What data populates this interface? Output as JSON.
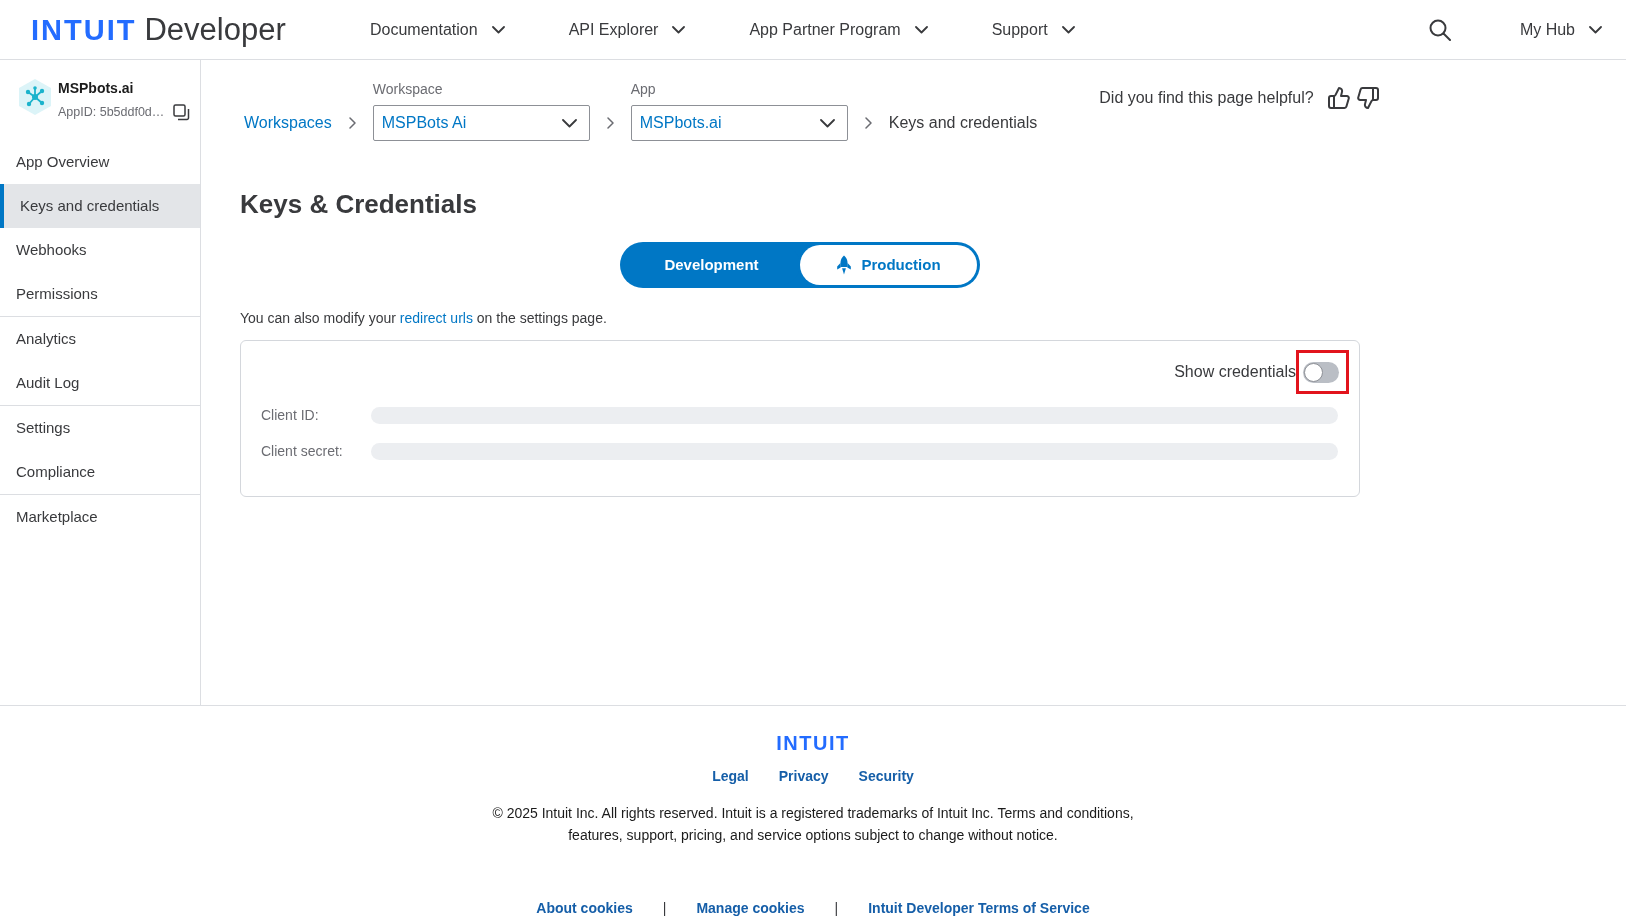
{
  "header": {
    "logo": "INTUIT",
    "product": "Developer",
    "nav": [
      {
        "label": "Documentation"
      },
      {
        "label": "API Explorer"
      },
      {
        "label": "App Partner Program"
      },
      {
        "label": "Support"
      }
    ],
    "account": {
      "label": "My Hub"
    }
  },
  "sidebar": {
    "app": {
      "name": "MSPbots.ai",
      "app_id": "AppID: 5b5ddf0d…"
    },
    "sections": [
      {
        "items": [
          {
            "label": "App Overview",
            "selected": false
          },
          {
            "label": "Keys and credentials",
            "selected": true
          },
          {
            "label": "Webhooks",
            "selected": false
          },
          {
            "label": "Permissions",
            "selected": false
          }
        ]
      },
      {
        "items": [
          {
            "label": "Analytics",
            "selected": false
          },
          {
            "label": "Audit Log",
            "selected": false
          }
        ]
      },
      {
        "items": [
          {
            "label": "Settings",
            "selected": false
          },
          {
            "label": "Compliance",
            "selected": false
          }
        ]
      },
      {
        "items": [
          {
            "label": "Marketplace",
            "selected": false
          }
        ]
      }
    ]
  },
  "breadcrumb": {
    "root": "Workspaces",
    "workspace": {
      "label": "Workspace",
      "value": "MSPBots Ai"
    },
    "app": {
      "label": "App",
      "value": "MSPbots.ai"
    },
    "current": "Keys and credentials"
  },
  "feedback": {
    "question": "Did you find this page helpful?"
  },
  "page": {
    "title": "Keys & Credentials",
    "environments": [
      {
        "label": "Development",
        "selected": true,
        "kind": "text"
      },
      {
        "label": "Production",
        "selected": false,
        "kind": "icon"
      }
    ],
    "note": {
      "before": "You can also modify your ",
      "link": "redirect urls",
      "after": " on the settings page."
    },
    "credentials": {
      "toggle": {
        "label": "Show credentials",
        "on": false,
        "highlighted": true
      },
      "fields": [
        {
          "label": "Client ID:"
        },
        {
          "label": "Client secret:"
        }
      ]
    }
  },
  "footer": {
    "logo": "INTUIT",
    "links": [
      "Legal",
      "Privacy",
      "Security"
    ],
    "copyright": [
      "© 2025 Intuit Inc. All rights reserved. Intuit is a registered trademarks of Intuit Inc. Terms and conditions,",
      "features, support, pricing, and service options subject to change without notice."
    ],
    "bottom_items": [
      {
        "kind": "link",
        "text": "About cookies"
      },
      {
        "kind": "separator",
        "text": "|"
      },
      {
        "kind": "link",
        "text": "Manage cookies"
      },
      {
        "kind": "separator",
        "text": "|"
      },
      {
        "kind": "link",
        "text": "Intuit Developer Terms of Service"
      }
    ]
  }
}
